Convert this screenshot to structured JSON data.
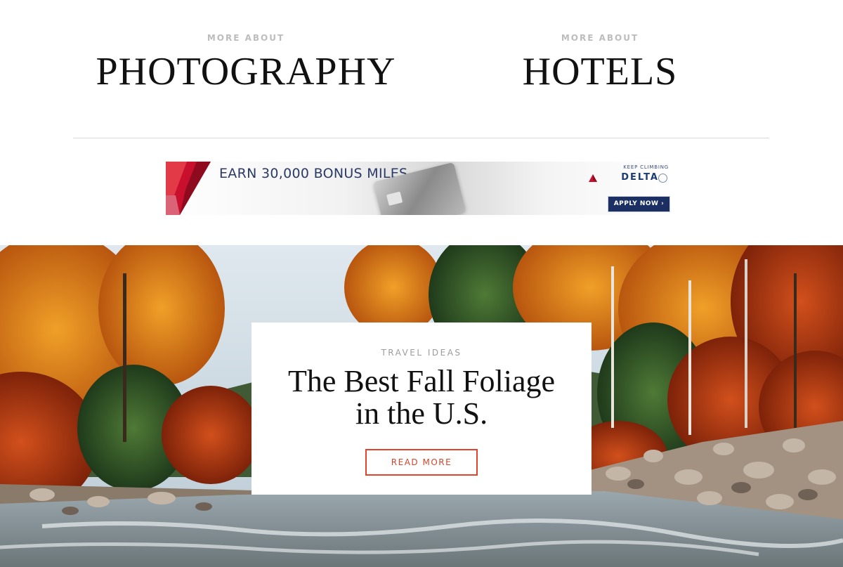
{
  "more_sections": [
    {
      "kicker": "MORE ABOUT",
      "title": "PHOTOGRAPHY"
    },
    {
      "kicker": "MORE ABOUT",
      "title": "HOTELS"
    }
  ],
  "ad": {
    "headline": "EARN 30,000 BONUS MILES.",
    "tagline": "KEEP CLIMBING",
    "brand": "DELTA",
    "cta": "APPLY NOW ›",
    "brand_color": "#1b2f63",
    "accent_color": "#c8102e"
  },
  "feature": {
    "kicker": "TRAVEL IDEAS",
    "title": "The Best Fall Foliage in the U.S.",
    "cta": "READ MORE",
    "cta_color": "#e0452b"
  }
}
